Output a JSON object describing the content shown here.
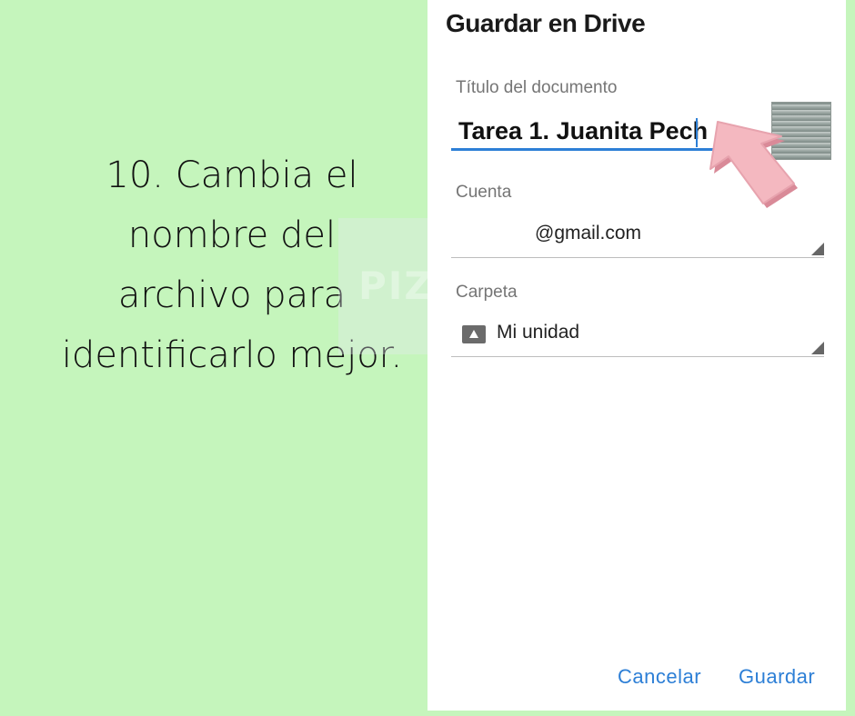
{
  "instruction": {
    "lines": [
      "10. Cambia el",
      "nombre del",
      "archivo para",
      "identificarlo mejor."
    ]
  },
  "watermark": {
    "text": "PIZCAS"
  },
  "dialog": {
    "title": "Guardar en Drive",
    "title_field": {
      "label": "Título del documento",
      "value": "Tarea 1. Juanita Pech"
    },
    "account_field": {
      "label": "Cuenta",
      "value": "@gmail.com"
    },
    "folder_field": {
      "label": "Carpeta",
      "value": "Mi unidad",
      "icon": "drive-folder-icon"
    },
    "buttons": {
      "cancel": "Cancelar",
      "save": "Guardar"
    }
  },
  "colors": {
    "background": "#c5f5bc",
    "accent": "#2d7fd6",
    "pointer": "#f4b8c0"
  }
}
